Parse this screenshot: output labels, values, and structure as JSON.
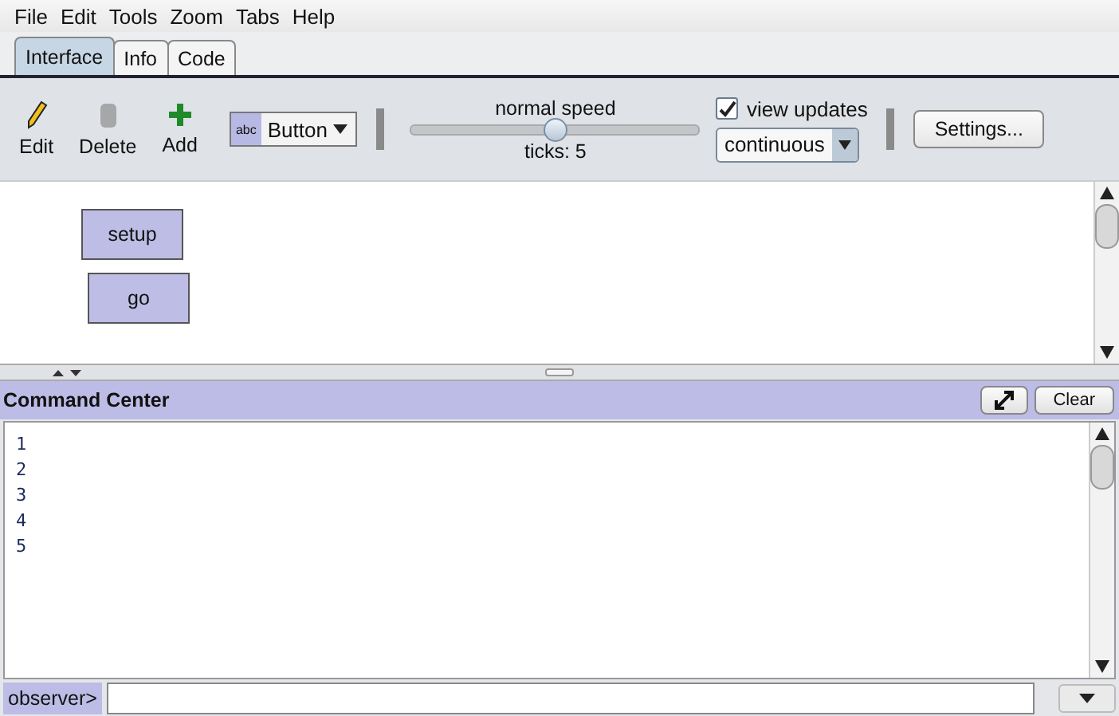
{
  "menu": [
    "File",
    "Edit",
    "Tools",
    "Zoom",
    "Tabs",
    "Help"
  ],
  "tabs": [
    {
      "label": "Interface",
      "selected": true
    },
    {
      "label": "Info",
      "selected": false
    },
    {
      "label": "Code",
      "selected": false
    }
  ],
  "toolbar": {
    "tools": [
      {
        "kind": "edit",
        "label": "Edit",
        "disabled": false
      },
      {
        "kind": "delete",
        "label": "Delete",
        "disabled": true
      },
      {
        "kind": "add",
        "label": "Add",
        "disabled": false
      }
    ],
    "widget_type": {
      "icon_text": "abc",
      "value": "Button"
    },
    "speed": {
      "label": "normal speed",
      "level": 0.5,
      "ticks": "ticks: 5"
    },
    "view_updates": {
      "label": "view updates",
      "checked": true
    },
    "update_mode": "continuous",
    "settings_button": "Settings..."
  },
  "interface_widgets": [
    {
      "kind": "button",
      "label": "setup"
    },
    {
      "kind": "button",
      "label": "go"
    }
  ],
  "command_center": {
    "title": "Command Center",
    "clear_button": "Clear",
    "output": [
      "1",
      "2",
      "3",
      "4",
      "5"
    ],
    "agent_label": "observer>"
  }
}
